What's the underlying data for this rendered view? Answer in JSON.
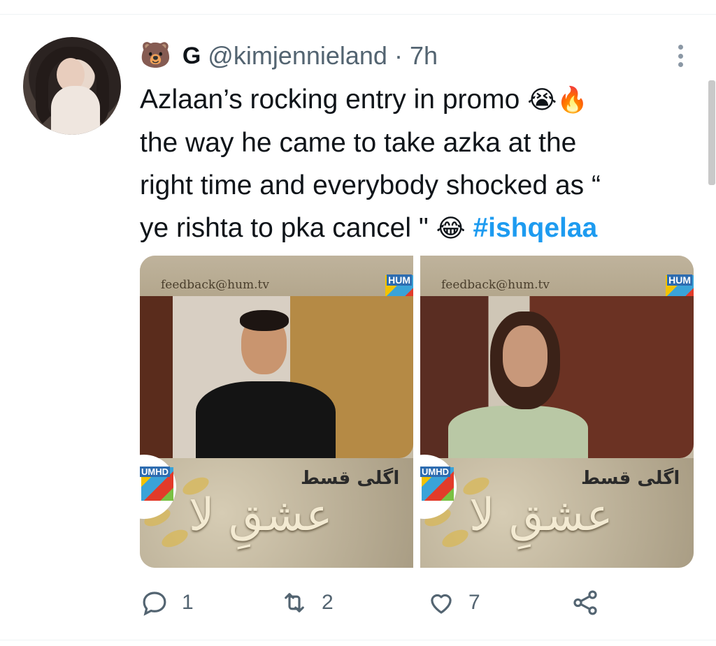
{
  "tweet": {
    "display_name_emoji": "🐻",
    "display_name_letter": "G",
    "handle": "@kimjennieland",
    "separator": "·",
    "time": "7h",
    "text_line1": "Azlaan’s rocking entry in promo",
    "emoji_cry": "😭",
    "emoji_fire": "🔥",
    "text_line2": "the way he came to take azka at the",
    "text_line3": "right time and everybody shocked as “",
    "text_line4": "ye rishta to pka cancel \"",
    "emoji_laugh": "😂",
    "hashtag": "#ishqelaa"
  },
  "media": {
    "left": {
      "email": "feedback@hum.tv",
      "logo": "HUM",
      "hd_logo": "UMHD",
      "urdu_small": "اگلی قسط",
      "urdu_big": "عشقِ لا"
    },
    "right": {
      "email": "feedback@hum.tv",
      "logo": "HUM",
      "hd_logo": "UMHD",
      "urdu_small": "اگلی قسط",
      "urdu_big": "عشقِ لا"
    }
  },
  "actions": {
    "reply_count": "1",
    "retweet_count": "2",
    "like_count": "7"
  },
  "colors": {
    "accent": "#1d9bf0",
    "secondary_text": "#536471",
    "primary_text": "#0f1419"
  },
  "icons": {
    "reply": "reply-icon",
    "retweet": "retweet-icon",
    "like": "heart-icon",
    "share": "share-icon",
    "more": "more-options-icon"
  }
}
